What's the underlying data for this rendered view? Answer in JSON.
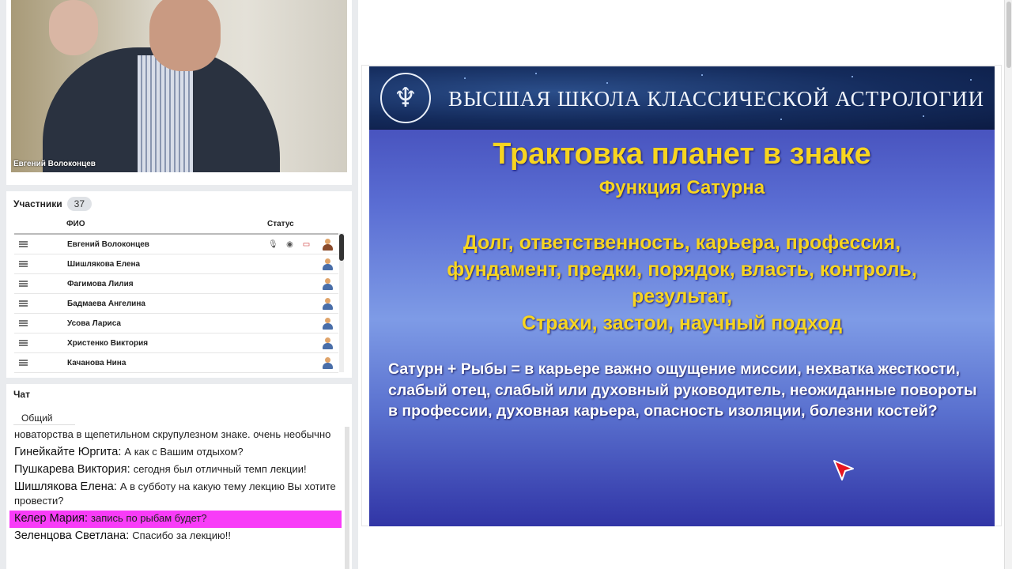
{
  "video": {
    "presenter_name": "Евгений Волоконцев"
  },
  "participants": {
    "title": "Участники",
    "count": "37",
    "col_name": "ФИО",
    "col_status": "Статус",
    "rows": [
      {
        "name": "Евгений Волоконцев"
      },
      {
        "name": "Шишлякова Елена"
      },
      {
        "name": "Фагимова Лилия"
      },
      {
        "name": "Бадмаева Ангелина"
      },
      {
        "name": "Усова Лариса"
      },
      {
        "name": "Христенко Виктория"
      },
      {
        "name": "Качанова Нина"
      }
    ]
  },
  "chat": {
    "title": "Чат",
    "tab": "Общий",
    "messages": [
      {
        "who": "",
        "text": "новаторства в щепетильном скрупулезном знаке. очень необычно"
      },
      {
        "who": "Гинейкайте Юргита:",
        "text": "А как с Вашим отдыхом?"
      },
      {
        "who": "Пушкарева Виктория:",
        "text": "сегодня был отличный темп лекции!"
      },
      {
        "who": "Шишлякова Елена:",
        "text": "А в субботу на какую тему лекцию Вы хотите провести?"
      },
      {
        "who": "Келер Мария:",
        "text": "запись по рыбам будет?"
      },
      {
        "who": "Зеленцова Светлана:",
        "text": "Спасибо за лекцию!!"
      }
    ],
    "highlight_color": "#f83cf8"
  },
  "slide": {
    "banner": "ВЫСШАЯ ШКОЛА КЛАССИЧЕСКОЙ АСТРОЛОГИИ",
    "title": "Трактовка планет в знаке",
    "subtitle": "Функция Сатурна",
    "keywords_line1": "Долг, ответственность, карьера, профессия,",
    "keywords_line2": "фундамент, предки, порядок, власть, контроль,",
    "keywords_line3": "результат,",
    "keywords_line4": "Страхи, застои, научный подход",
    "body": "Сатурн + Рыбы = в карьере важно ощущение миссии, нехватка жесткости, слабый отец, слабый или духовный руководитель, неожиданные повороты в профессии, духовная карьера, опасность изоляции, болезни костей?",
    "accent_yellow": "#f7d520"
  }
}
